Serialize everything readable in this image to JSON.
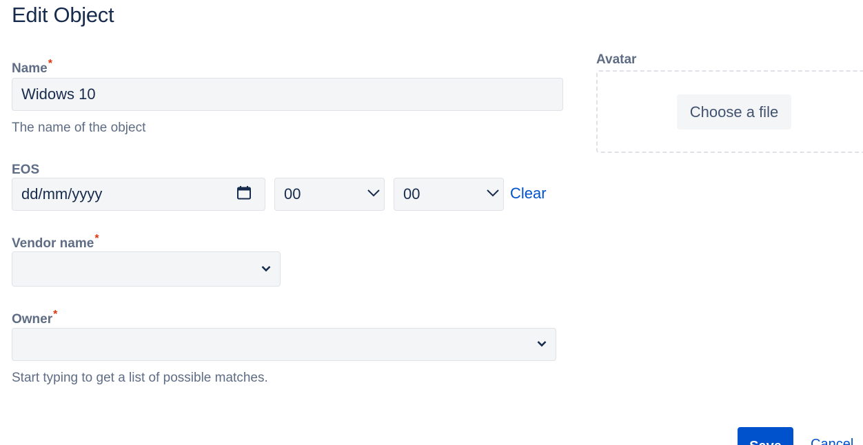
{
  "page": {
    "title": "Edit Object"
  },
  "name_field": {
    "label": "Name",
    "required_mark": "*",
    "value": "Widows 10",
    "help": "The name of the object"
  },
  "eos_field": {
    "label": "EOS",
    "date_placeholder": "dd/mm/yyyy",
    "hour_value": "00",
    "minute_value": "00",
    "clear_label": "Clear",
    "date_icon": "calendar-icon"
  },
  "vendor_field": {
    "label": "Vendor name",
    "required_mark": "*",
    "value": ""
  },
  "owner_field": {
    "label": "Owner",
    "required_mark": "*",
    "value": "",
    "help": "Start typing to get a list of possible matches."
  },
  "avatar": {
    "label": "Avatar",
    "choose_label": "Choose a file"
  },
  "actions": {
    "save_label": "Save",
    "cancel_label": "Cancel"
  },
  "colors": {
    "accent": "#0052cc",
    "required": "#de350b",
    "field_bg": "#f4f5f7",
    "label": "#5e6c84"
  }
}
